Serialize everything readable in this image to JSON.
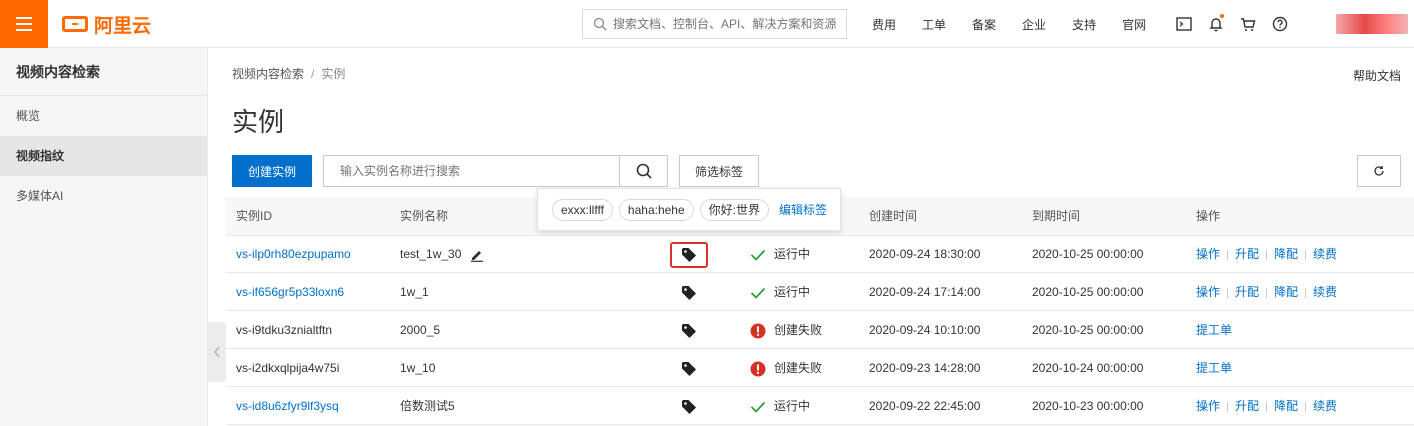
{
  "topbar": {
    "logo_text": "阿里云",
    "search_placeholder": "搜索文档、控制台、API、解决方案和资源",
    "nav": [
      "费用",
      "工单",
      "备案",
      "企业",
      "支持",
      "官网"
    ],
    "icons": [
      "terminal-icon",
      "bell-icon",
      "cart-icon",
      "help-icon"
    ],
    "accent": "#ff6a00"
  },
  "sidebar": {
    "title": "视频内容检索",
    "items": [
      {
        "label": "概览",
        "active": false
      },
      {
        "label": "视频指纹",
        "active": true
      },
      {
        "label": "多媒体AI",
        "active": false
      }
    ]
  },
  "breadcrumb": {
    "root": "视频内容检索",
    "sep": "/",
    "current": "实例"
  },
  "help_doc": "帮助文档",
  "page_title": "实例",
  "toolbar": {
    "create_label": "创建实例",
    "search_placeholder": "输入实例名称进行搜索",
    "filter_label": "筛选标签"
  },
  "popover": {
    "tags": [
      "exxx:llfff",
      "haha:hehe",
      "你好:世界"
    ],
    "edit_label": "编辑标签"
  },
  "table": {
    "columns": {
      "id": "实例ID",
      "name": "实例名称",
      "created": "创建时间",
      "expire": "到期时间",
      "ops": "操作"
    },
    "rows": [
      {
        "id": "vs-ilp0rh80ezpupamo",
        "id_link": true,
        "name": "test_1w_30",
        "editable": true,
        "status": "运行中",
        "status_type": "ok",
        "created": "2020-09-24 18:30:00",
        "expire": "2020-10-25 00:00:00",
        "ops": [
          "操作",
          "升配",
          "降配",
          "续费"
        ]
      },
      {
        "id": "vs-if656gr5p33loxn6",
        "id_link": true,
        "name": "1w_1",
        "editable": false,
        "status": "运行中",
        "status_type": "ok",
        "created": "2020-09-24 17:14:00",
        "expire": "2020-10-25 00:00:00",
        "ops": [
          "操作",
          "升配",
          "降配",
          "续费"
        ]
      },
      {
        "id": "vs-i9tdku3znialtftn",
        "id_link": false,
        "name": "2000_5",
        "editable": false,
        "status": "创建失败",
        "status_type": "fail",
        "created": "2020-09-24 10:10:00",
        "expire": "2020-10-25 00:00:00",
        "ops": [
          "提工单"
        ]
      },
      {
        "id": "vs-i2dkxqlpija4w75i",
        "id_link": false,
        "name": "1w_10",
        "editable": false,
        "status": "创建失败",
        "status_type": "fail",
        "created": "2020-09-23 14:28:00",
        "expire": "2020-10-24 00:00:00",
        "ops": [
          "提工单"
        ]
      },
      {
        "id": "vs-id8u6zfyr9lf3ysq",
        "id_link": true,
        "name": "倍数测试5",
        "editable": false,
        "status": "运行中",
        "status_type": "ok",
        "created": "2020-09-22 22:45:00",
        "expire": "2020-10-23 00:00:00",
        "ops": [
          "操作",
          "升配",
          "降配",
          "续费"
        ]
      }
    ]
  },
  "colors": {
    "link": "#0070cc",
    "ok": "#2e9e3e",
    "fail": "#d93026",
    "highlight": "#d9332e"
  }
}
